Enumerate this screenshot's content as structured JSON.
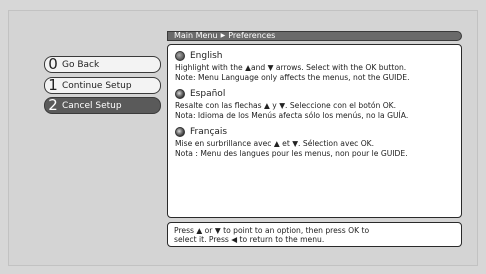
{
  "menu": {
    "back": {
      "num": "0",
      "label": "Go Back"
    },
    "continue": {
      "num": "1",
      "label": "Continue Setup"
    },
    "cancel": {
      "num": "2",
      "label": "Cancel Setup"
    }
  },
  "header": {
    "root": "Main Menu",
    "arrow": "▶",
    "page": "Preferences"
  },
  "languages": [
    {
      "name": "English",
      "line1": "Highlight with the ▲and ▼ arrows. Select with the OK button.",
      "line2": "Note: Menu Language only affects the menus, not the GUIDE."
    },
    {
      "name": "Español",
      "line1": "Resalte con las flechas ▲ y ▼. Seleccione con el botón OK.",
      "line2": "Nota: Idioma de los Menús afecta sólo los menús, no la GUÍA."
    },
    {
      "name": "Français",
      "line1": "Mise en surbrillance avec ▲ et ▼. Sélection avec OK.",
      "line2": "Nota : Menu des langues pour les menus, non pour le GUIDE."
    }
  ],
  "help": {
    "line1": "Press ▲ or ▼ to point to an option, then press OK to",
    "line2": "select it. Press ◀ to return to the menu."
  }
}
